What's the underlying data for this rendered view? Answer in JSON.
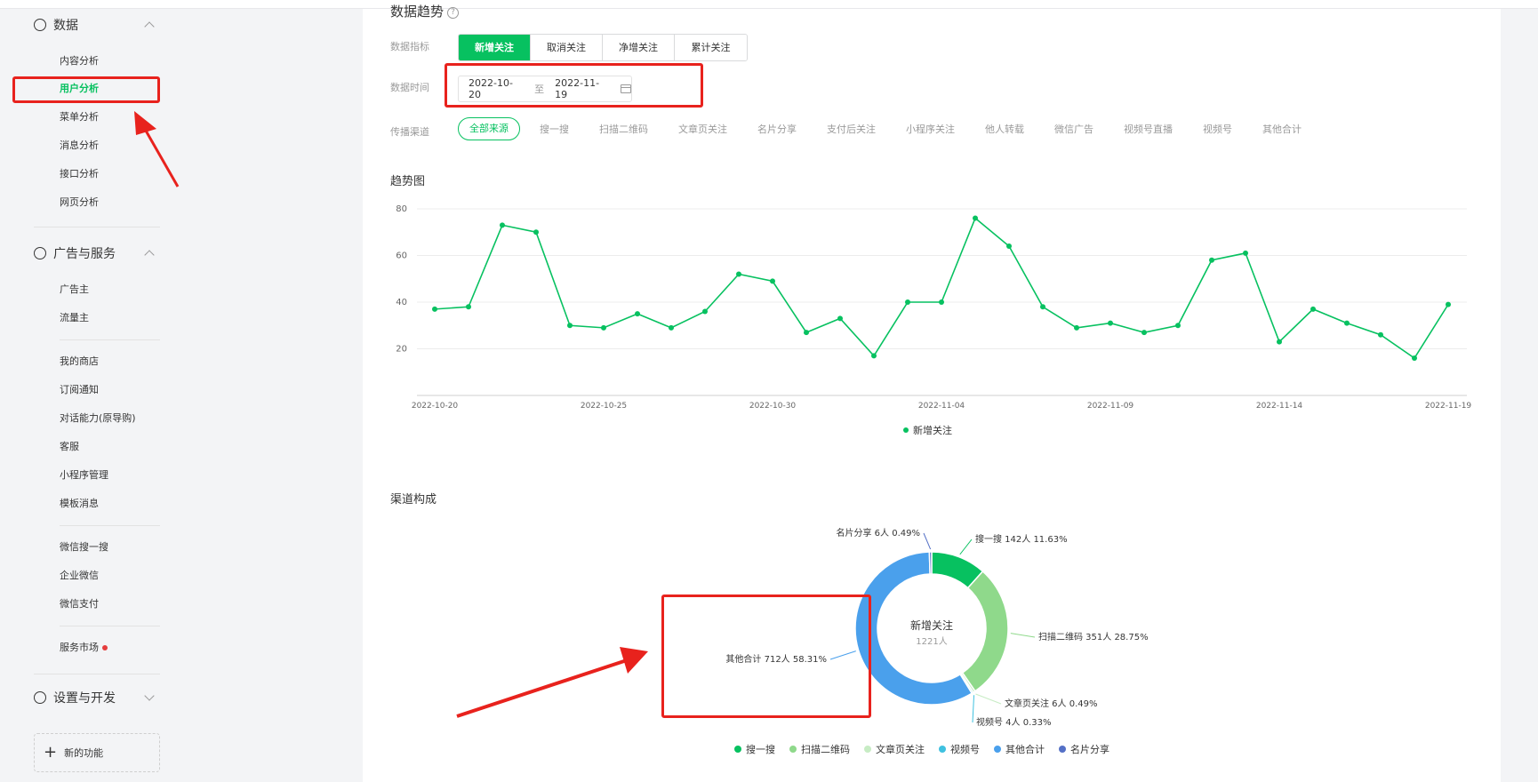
{
  "sidebar": {
    "sections": [
      {
        "label": "数据",
        "icon": "pie-chart-icon"
      },
      {
        "label": "广告与服务",
        "icon": "compass-icon"
      },
      {
        "label": "设置与开发",
        "icon": "gear-icon"
      }
    ],
    "data_items": [
      "内容分析",
      "用户分析",
      "菜单分析",
      "消息分析",
      "接口分析",
      "网页分析"
    ],
    "ads_items": [
      "广告主",
      "流量主"
    ],
    "store_items": [
      "我的商店",
      "订阅通知",
      "对话能力(原导购)",
      "客服",
      "小程序管理",
      "模板消息"
    ],
    "wechat_items": [
      "微信搜一搜",
      "企业微信",
      "微信支付"
    ],
    "service_market": "服务市场",
    "new_feature": "新的功能"
  },
  "main": {
    "title": "数据趋势",
    "metric_label": "数据指标",
    "metrics": [
      "新增关注",
      "取消关注",
      "净增关注",
      "累计关注"
    ],
    "time_label": "数据时间",
    "date_start": "2022-10-20",
    "date_to": "至",
    "date_end": "2022-11-19",
    "channel_label": "传播渠道",
    "channels": [
      "全部来源",
      "搜一搜",
      "扫描二维码",
      "文章页关注",
      "名片分享",
      "支付后关注",
      "小程序关注",
      "他人转载",
      "微信广告",
      "视频号直播",
      "视频号",
      "其他合计"
    ],
    "trend_title": "趋势图",
    "composition_title": "渠道构成"
  },
  "colors": {
    "accent": "#07c160",
    "annotation": "#e8221d",
    "line": "#07c160"
  },
  "chart_data": [
    {
      "type": "line",
      "ylim": [
        0,
        80
      ],
      "yticks": [
        20,
        40,
        60,
        80
      ],
      "xtick_labels": [
        "2022-10-20",
        "2022-10-25",
        "2022-10-30",
        "2022-11-04",
        "2022-11-09",
        "2022-11-14",
        "2022-11-19"
      ],
      "x": [
        "2022-10-20",
        "2022-10-21",
        "2022-10-22",
        "2022-10-23",
        "2022-10-24",
        "2022-10-25",
        "2022-10-26",
        "2022-10-27",
        "2022-10-28",
        "2022-10-29",
        "2022-10-30",
        "2022-10-31",
        "2022-11-01",
        "2022-11-02",
        "2022-11-03",
        "2022-11-04",
        "2022-11-05",
        "2022-11-06",
        "2022-11-07",
        "2022-11-08",
        "2022-11-09",
        "2022-11-10",
        "2022-11-11",
        "2022-11-12",
        "2022-11-13",
        "2022-11-14",
        "2022-11-15",
        "2022-11-16",
        "2022-11-17",
        "2022-11-18",
        "2022-11-19"
      ],
      "series": [
        {
          "name": "新增关注",
          "values": [
            37,
            38,
            73,
            70,
            30,
            29,
            35,
            29,
            36,
            52,
            49,
            27,
            33,
            17,
            40,
            40,
            76,
            64,
            38,
            29,
            31,
            27,
            30,
            58,
            61,
            23,
            37,
            31,
            26,
            16,
            39
          ]
        }
      ],
      "legend": "bottom-center"
    },
    {
      "type": "pie",
      "center_title": "新增关注",
      "center_value": "1221人",
      "slices": [
        {
          "name": "搜一搜",
          "label": "搜一搜 142人 11.63%",
          "value": 142,
          "color": "#07c160"
        },
        {
          "name": "扫描二维码",
          "label": "扫描二维码 351人 28.75%",
          "value": 351,
          "color": "#8fd98b"
        },
        {
          "name": "文章页关注",
          "label": "文章页关注 6人 0.49%",
          "value": 6,
          "color": "#c7ecc4"
        },
        {
          "name": "视频号",
          "label": "视频号 4人 0.33%",
          "value": 4,
          "color": "#3fc1e0"
        },
        {
          "name": "其他合计",
          "label": "其他合计 712人 58.31%",
          "value": 712,
          "color": "#4aa0ec"
        },
        {
          "name": "名片分享",
          "label": "名片分享 6人 0.49%",
          "value": 6,
          "color": "#5470c6"
        }
      ],
      "legend": "bottom-center"
    }
  ]
}
